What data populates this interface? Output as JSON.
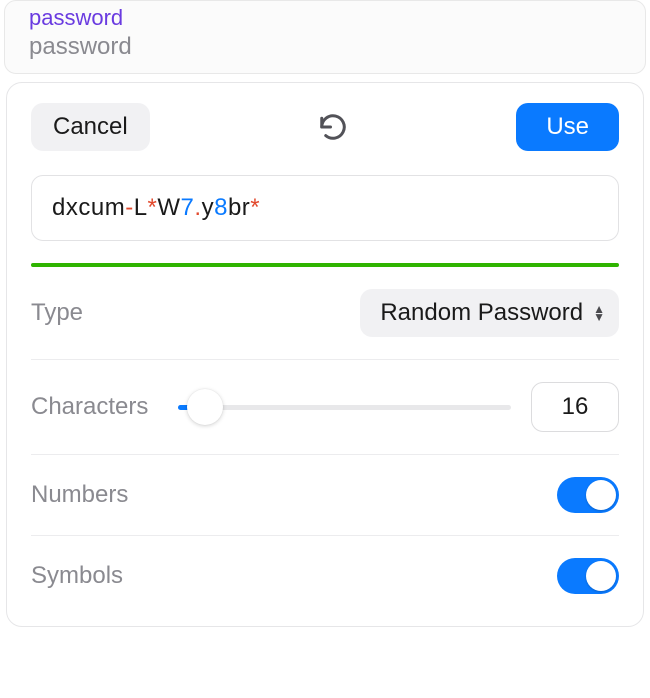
{
  "header": {
    "title": "password",
    "subtitle": "password"
  },
  "toolbar": {
    "cancel_label": "Cancel",
    "use_label": "Use"
  },
  "password": {
    "segments": [
      {
        "text": "dxcum",
        "class": ""
      },
      {
        "text": "-",
        "class": "pw-symbol"
      },
      {
        "text": "L",
        "class": ""
      },
      {
        "text": "*",
        "class": "pw-symbol"
      },
      {
        "text": "W",
        "class": ""
      },
      {
        "text": "7",
        "class": "pw-number"
      },
      {
        "text": ".",
        "class": "pw-symbol"
      },
      {
        "text": "y",
        "class": ""
      },
      {
        "text": "8",
        "class": "pw-number"
      },
      {
        "text": "br",
        "class": ""
      },
      {
        "text": "*",
        "class": "pw-symbol"
      }
    ],
    "strength_color": "#2fb400"
  },
  "options": {
    "type": {
      "label": "Type",
      "value": "Random Password"
    },
    "characters": {
      "label": "Characters",
      "value": "16",
      "slider_percent": 8
    },
    "numbers": {
      "label": "Numbers",
      "on": true
    },
    "symbols": {
      "label": "Symbols",
      "on": true
    }
  }
}
